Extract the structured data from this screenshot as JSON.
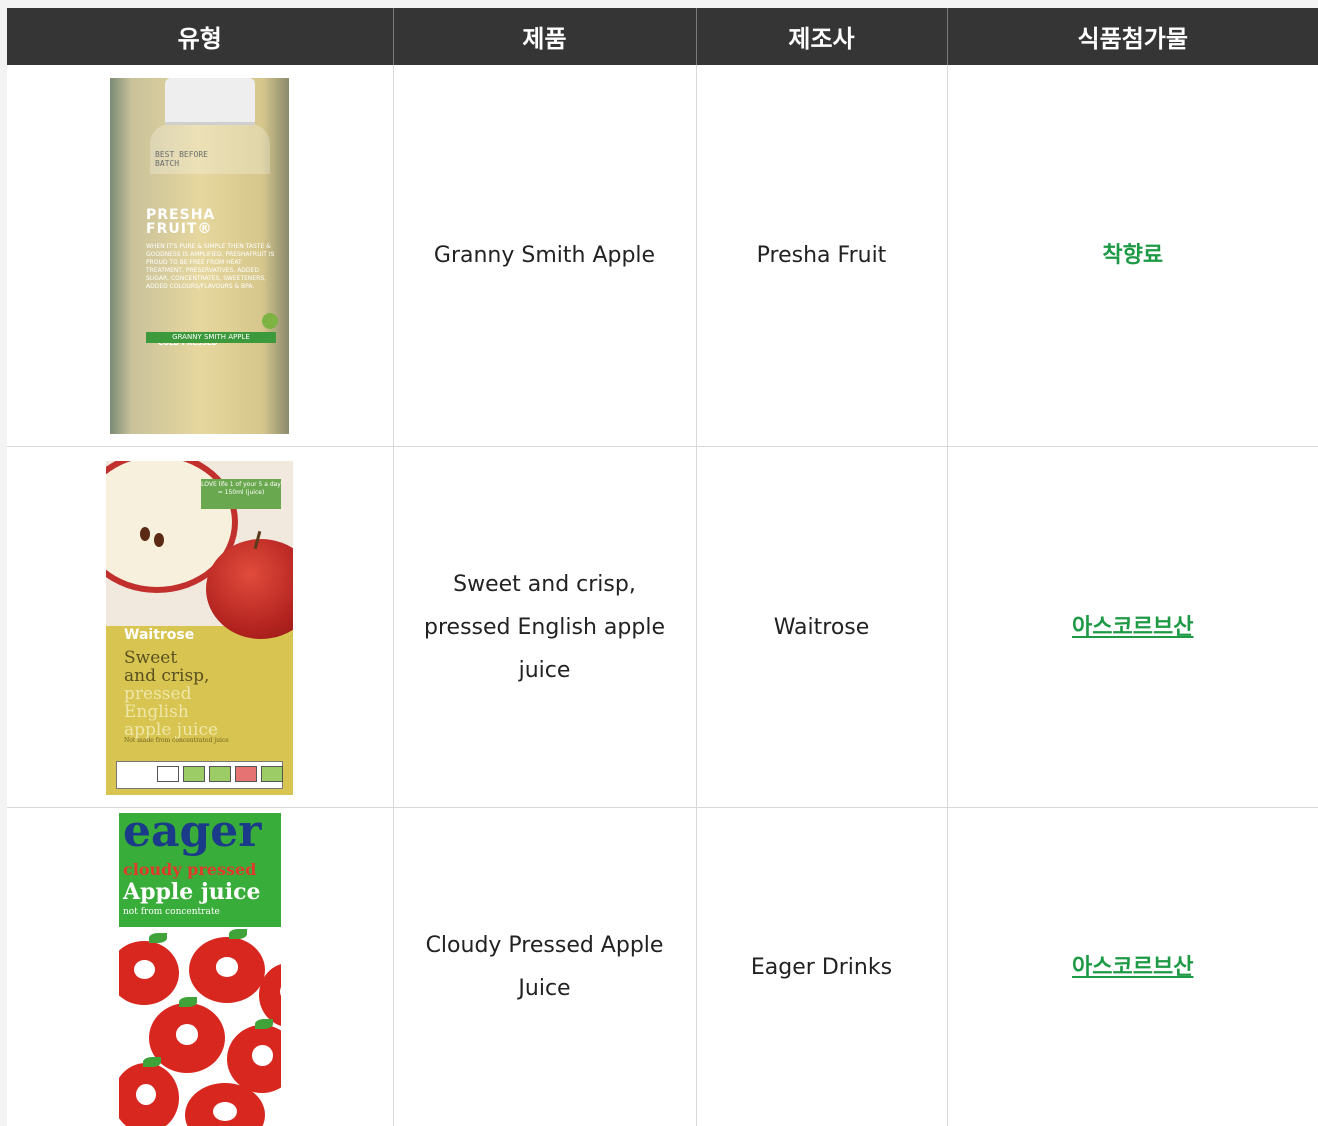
{
  "headers": {
    "type": "유형",
    "product": "제품",
    "maker": "제조사",
    "additive": "식품첨가물"
  },
  "rows": [
    {
      "product": "Granny Smith Apple",
      "maker": "Presha Fruit",
      "additive": "착향료",
      "image": {
        "batch_line1": "BEST BEFORE",
        "batch_line2": "BATCH",
        "brand_line1": "PRESHA",
        "brand_line2": "FRUIT®",
        "fine_print": "WHEN IT'S PURE & SIMPLE THEN TASTE & GOODNESS IS AMPLIFIED. PRESHAFRUIT IS PROUD TO BE FREE FROM HEAT TREATMENT, PRESERVATIVES, ADDED SUGAR, CONCENTRATES, SWEETENERS, ADDED COLOURS/FLAVOURS & BPA.",
        "cold": "COLD PRESSED",
        "label": "GRANNY SMITH APPLE"
      }
    },
    {
      "product": "Sweet and crisp, pressed English apple juice",
      "maker": "Waitrose",
      "additive": "아스코르브산",
      "image": {
        "badge": "LOVE life 1 of your 5 a day = 150ml (juice)",
        "brand": "Waitrose",
        "line1": "Sweet",
        "line2": "and crisp,",
        "line3": "pressed",
        "line4": "English",
        "line5": "apple juice",
        "note": "Not made from concentrated juice"
      }
    },
    {
      "product": "Cloudy Pressed Apple Juice",
      "maker": "Eager Drinks",
      "additive": "아스코르브산",
      "image": {
        "logo": "eager",
        "line1": "cloudy pressed",
        "line2": "Apple juice",
        "line3": "not from concentrate"
      }
    }
  ],
  "colors": {
    "header_bg": "#353535",
    "additive_green": "#1e9a46"
  }
}
